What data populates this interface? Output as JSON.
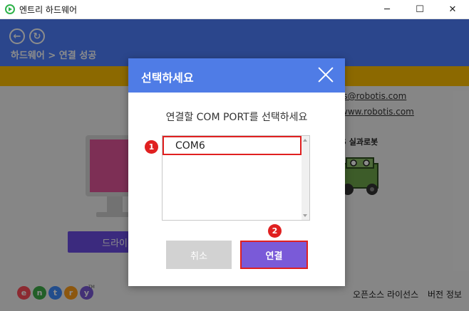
{
  "window": {
    "title": "엔트리 하드웨어",
    "controls": {
      "minimize": "─",
      "maximize": "☐",
      "close": "✕"
    }
  },
  "header": {
    "back_icon": "←",
    "refresh_icon": "↻",
    "breadcrumb": "하드웨어 > 연결 성공"
  },
  "background": {
    "email": "is@robotis.com",
    "website": "www.robotis.com",
    "robot_label": "S 실과로봇",
    "driver_button": "드라이",
    "logo_letters": [
      "e",
      "n",
      "t",
      "r",
      "y"
    ],
    "logo_colors": [
      "#ff4d5a",
      "#3fae49",
      "#3f8cff",
      "#ff9f1a",
      "#7a5ad8"
    ],
    "logo_tm": "TM",
    "footer": {
      "license": "오픈소스 라이선스",
      "version": "버전 정보"
    }
  },
  "dialog": {
    "title": "선택하세요",
    "prompt": "연결할 COM PORT를 선택하세요",
    "ports": [
      "COM6"
    ],
    "selected_port": "COM6",
    "cancel_label": "취소",
    "connect_label": "연결",
    "step_badges": [
      "1",
      "2"
    ]
  },
  "colors": {
    "header_blue": "#4f80ff",
    "dialog_header": "#4f7ce6",
    "accent_purple": "#7a5ad8",
    "highlight_red": "#e02020",
    "banner_yellow": "#ffc000"
  }
}
